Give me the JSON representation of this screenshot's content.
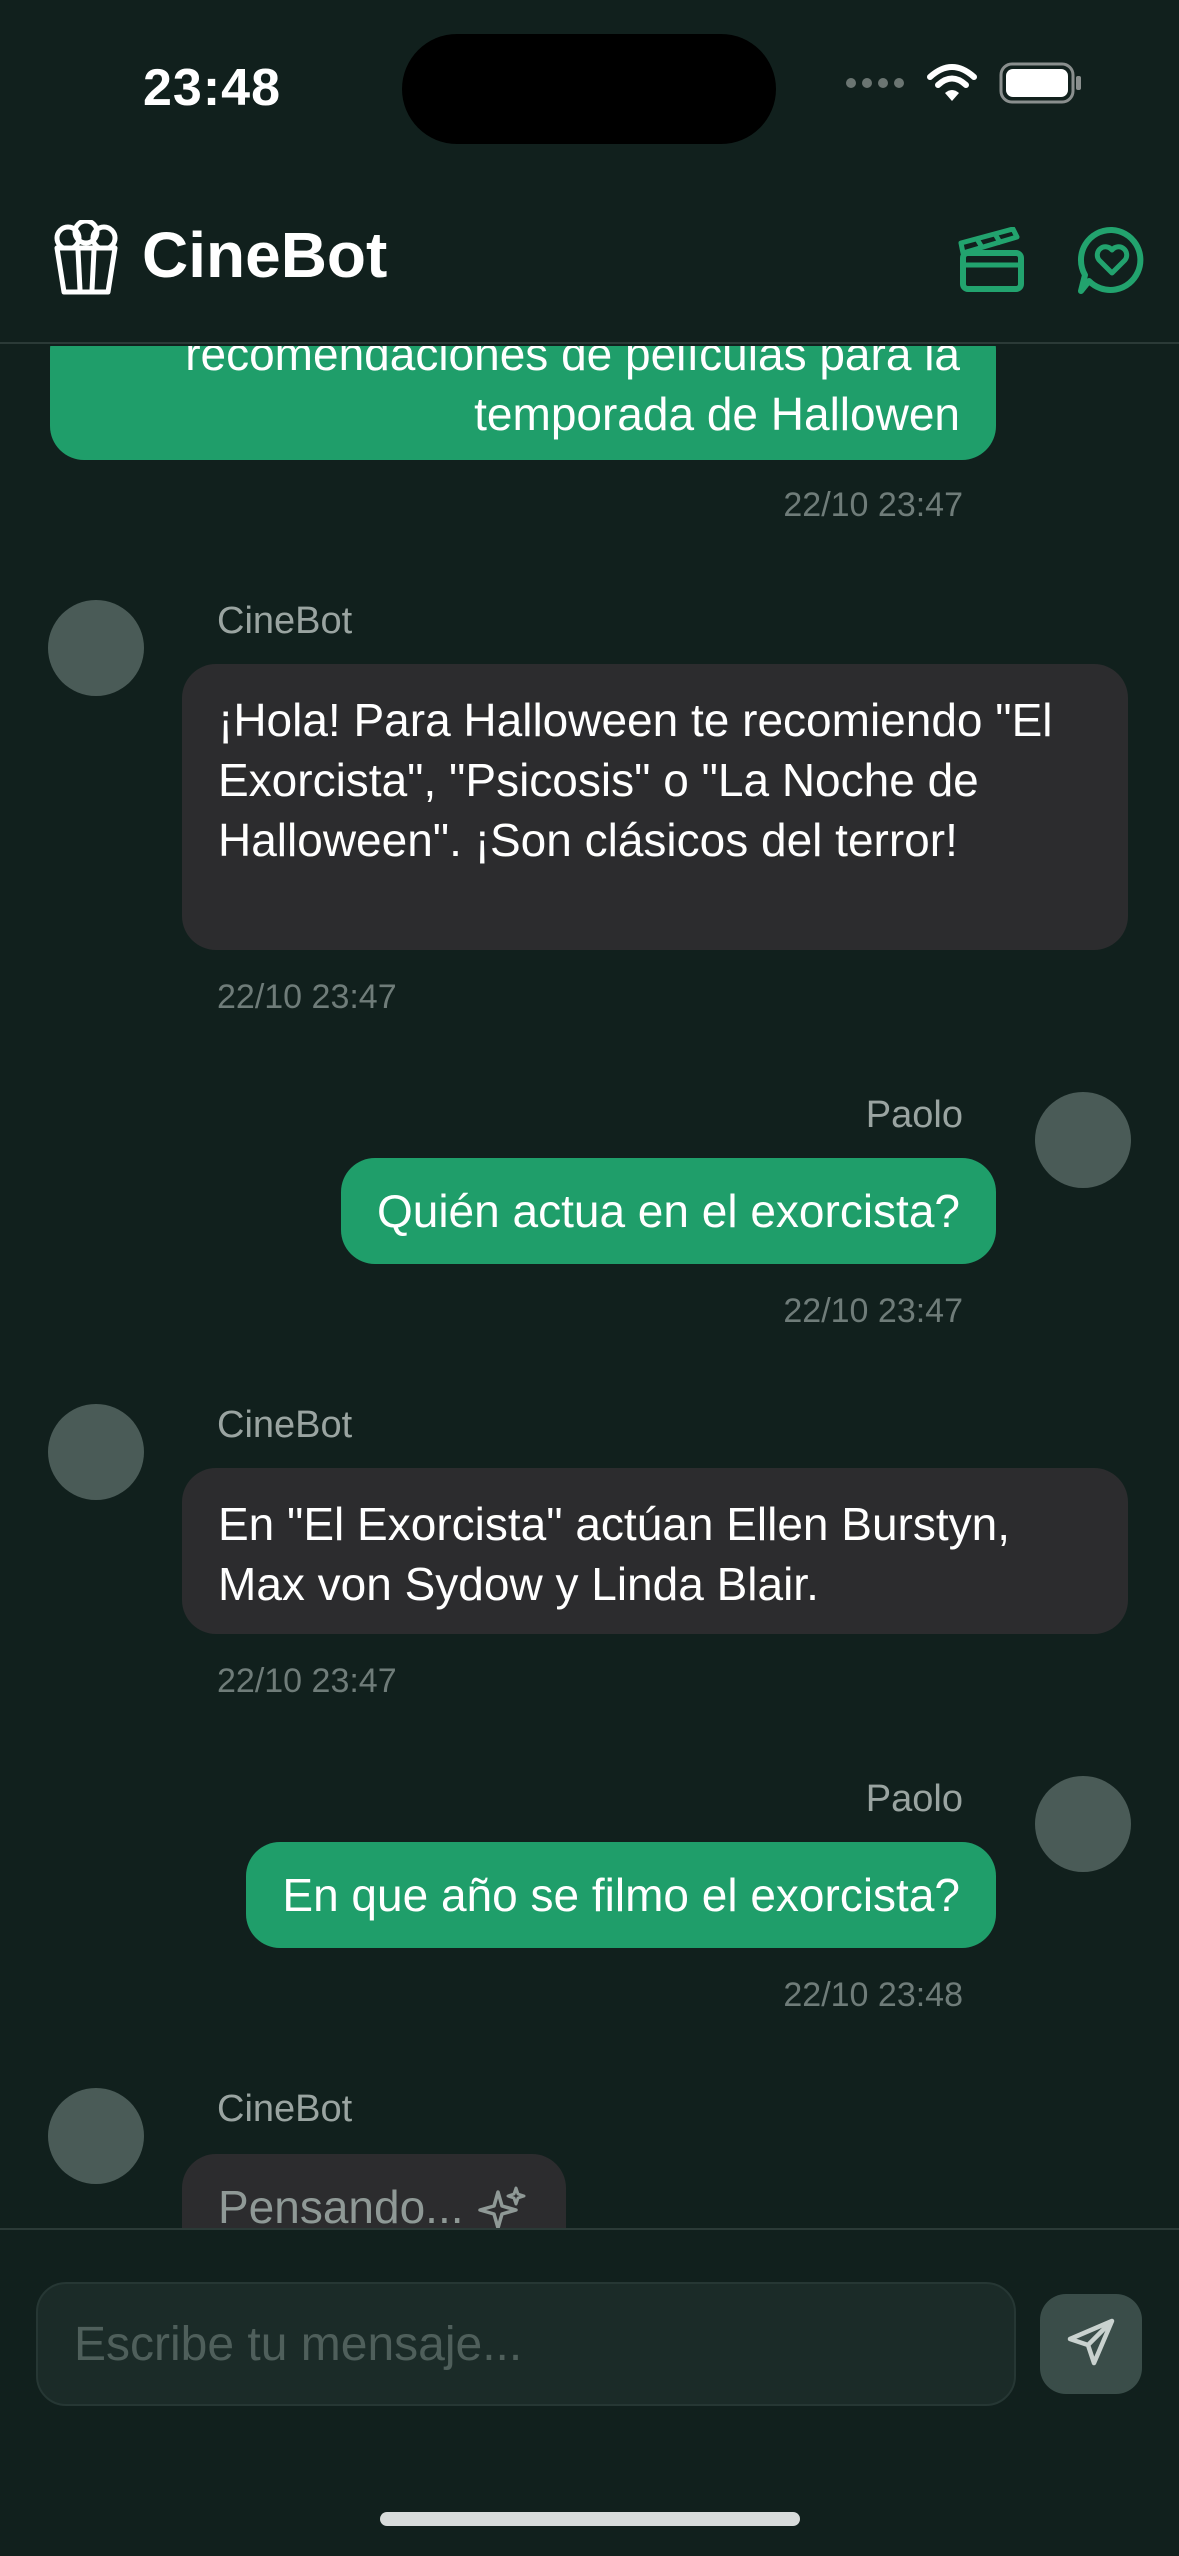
{
  "status_bar": {
    "time": "23:48"
  },
  "header": {
    "title": "CineBot",
    "logo_icon": "popcorn-icon",
    "actions": [
      {
        "icon": "clapperboard-icon"
      },
      {
        "icon": "chat-heart-icon"
      }
    ]
  },
  "colors": {
    "background": "#11201d",
    "accent": "#1f9e6a",
    "bot_bubble": "#2c2c2e",
    "avatar": "#4a5b57"
  },
  "messages": [
    {
      "role": "user",
      "text_line1": "recomendaciones de películas para la",
      "text_line2": "temporada de Hallowen",
      "time": "22/10 23:47"
    },
    {
      "role": "bot",
      "sender": "CineBot",
      "text": "¡Hola! Para Halloween te recomiendo \"El Exorcista\", \"Psicosis\" o \"La Noche de Halloween\". ¡Son clásicos del terror!",
      "time": "22/10 23:47"
    },
    {
      "role": "user",
      "sender": "Paolo",
      "text": "Quién actua en el exorcista?",
      "time": "22/10 23:47"
    },
    {
      "role": "bot",
      "sender": "CineBot",
      "text": "En \"El Exorcista\" actúan Ellen Burstyn, Max von Sydow y Linda Blair.",
      "time": "22/10 23:47"
    },
    {
      "role": "user",
      "sender": "Paolo",
      "text": "En que año se filmo el exorcista?",
      "time": "22/10 23:48"
    },
    {
      "role": "bot",
      "sender": "CineBot",
      "text": "Pensando...",
      "icon": "sparkles-icon"
    }
  ],
  "composer": {
    "placeholder": "Escribe tu mensaje...",
    "send_icon": "send-icon"
  }
}
